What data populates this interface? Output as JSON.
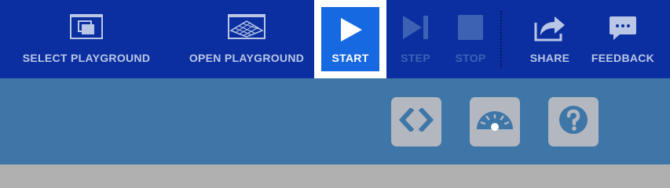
{
  "toolbar": {
    "buttons": [
      {
        "id": "select-playground",
        "label": "SELECT PLAYGROUND",
        "icon": "window-stack-icon",
        "enabled": true
      },
      {
        "id": "open-playground",
        "label": "OPEN PLAYGROUND",
        "icon": "grid-fabric-icon",
        "enabled": true
      },
      {
        "id": "start",
        "label": "START",
        "icon": "play-icon",
        "enabled": true,
        "active": true
      },
      {
        "id": "step",
        "label": "STEP",
        "icon": "step-forward-icon",
        "enabled": false
      },
      {
        "id": "stop",
        "label": "STOP",
        "icon": "stop-icon",
        "enabled": false
      },
      {
        "id": "share",
        "label": "SHARE",
        "icon": "share-icon",
        "enabled": true
      },
      {
        "id": "feedback",
        "label": "FEEDBACK",
        "icon": "speech-bubble-icon",
        "enabled": true
      }
    ]
  },
  "panel": {
    "buttons": [
      {
        "id": "code",
        "icon": "code-brackets-icon"
      },
      {
        "id": "speed",
        "icon": "speedometer-icon"
      },
      {
        "id": "help",
        "icon": "help-icon"
      }
    ]
  },
  "colors": {
    "toolbar_bg": "#0b2fa0",
    "start_bg": "#1669e0",
    "panel_bg": "#3f76a8",
    "panel_button": "#b3b7bf",
    "enabled_text": "#b9c6e6",
    "disabled_text": "#3d62b3"
  }
}
